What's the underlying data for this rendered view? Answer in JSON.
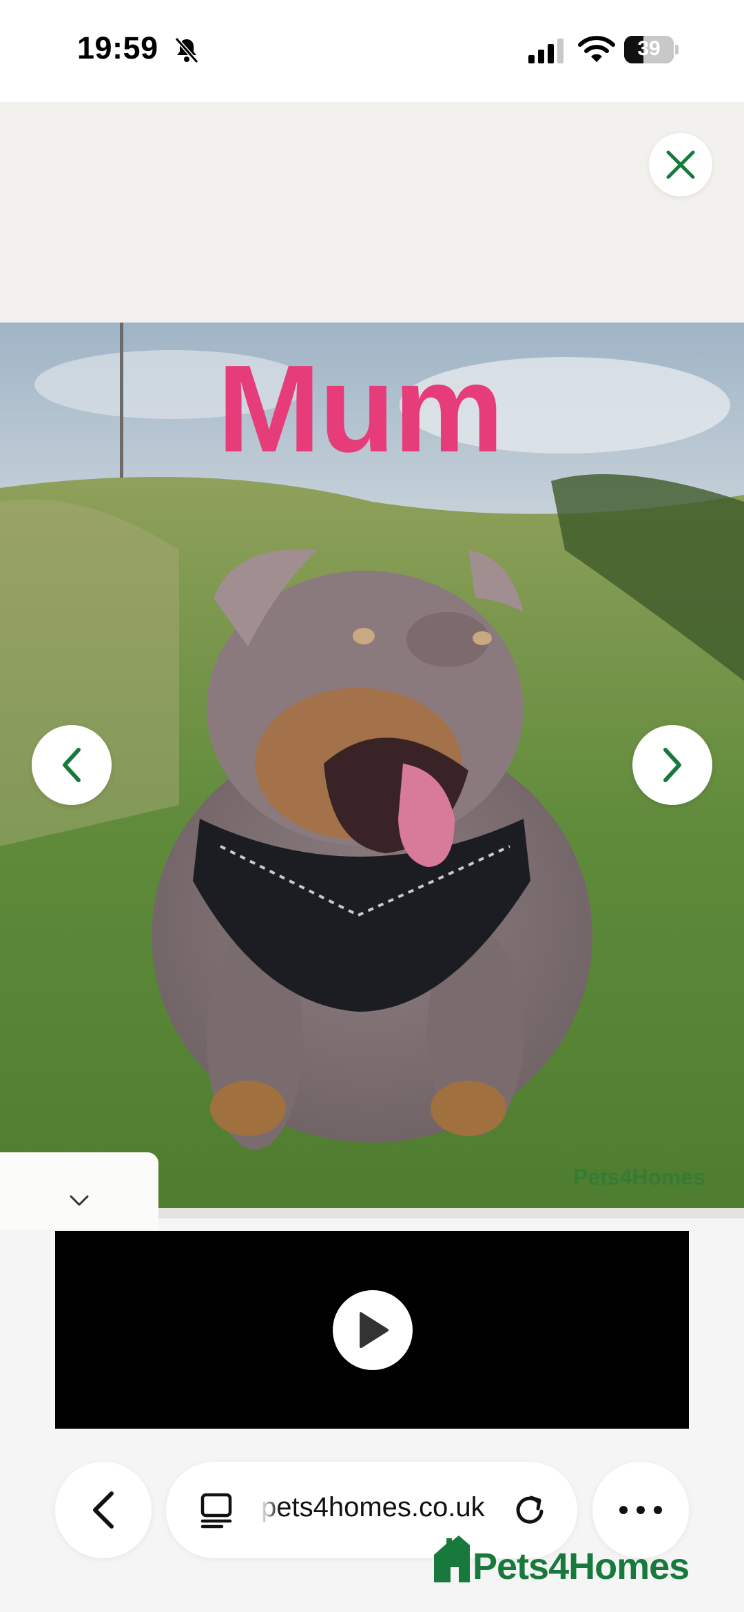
{
  "status_bar": {
    "time": "19:59",
    "battery": "39",
    "battery_level": 0.39
  },
  "photo": {
    "caption": "Mum",
    "watermark": "Pets4Homes"
  },
  "browser": {
    "url": "pets4homes.co.uk"
  },
  "brand": {
    "name": "Pets4Homes"
  },
  "colors": {
    "accent_green": "#177a3c",
    "caption_pink": "#e63d7a"
  },
  "icons": [
    "bell-slash-icon",
    "signal-icon",
    "wifi-icon",
    "close-icon",
    "chevron-left-icon",
    "chevron-right-icon",
    "chevron-down-icon",
    "play-icon",
    "tabs-icon",
    "reload-icon",
    "more-icon"
  ]
}
